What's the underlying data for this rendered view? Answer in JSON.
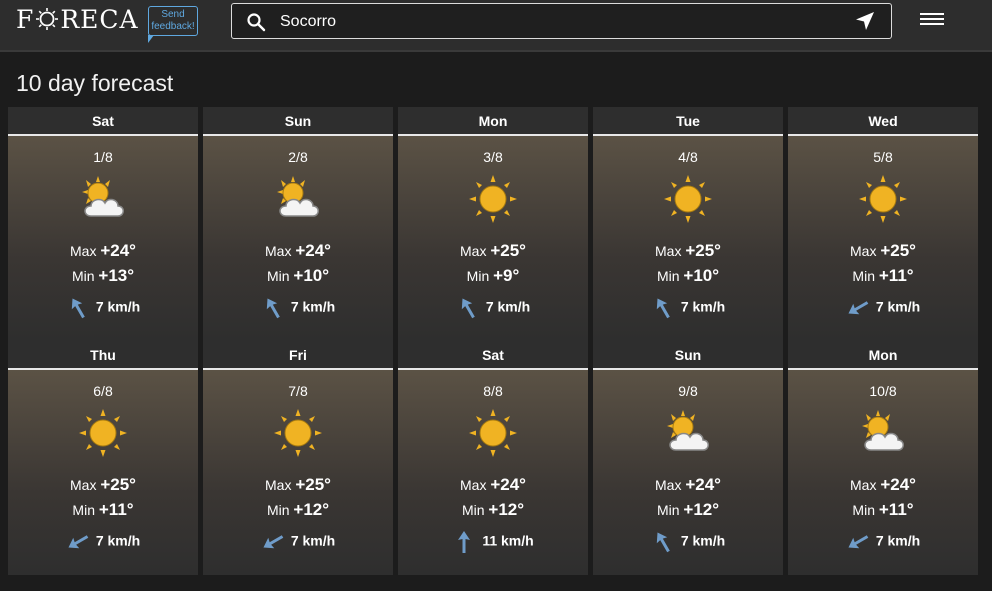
{
  "header": {
    "logo_text_left": "F",
    "logo_text_right": "RECA",
    "feedback_line1": "Send",
    "feedback_line2": "feedback!",
    "search_value": "Socorro",
    "colors": {
      "accent": "#5fa8e0",
      "sun": "#f0b323"
    }
  },
  "page": {
    "title": "10 day forecast"
  },
  "labels": {
    "max": "Max",
    "min": "Min"
  },
  "days": [
    {
      "day": "Sat",
      "date": "1/8",
      "icon": "partly-cloudy-icon",
      "max": "+24°",
      "min": "+13°",
      "wind": "7 km/h",
      "wind_dir": "nw"
    },
    {
      "day": "Sun",
      "date": "2/8",
      "icon": "partly-cloudy-icon",
      "max": "+24°",
      "min": "+10°",
      "wind": "7 km/h",
      "wind_dir": "nw"
    },
    {
      "day": "Mon",
      "date": "3/8",
      "icon": "sun-icon",
      "max": "+25°",
      "min": "+9°",
      "wind": "7 km/h",
      "wind_dir": "nw"
    },
    {
      "day": "Tue",
      "date": "4/8",
      "icon": "sun-icon",
      "max": "+25°",
      "min": "+10°",
      "wind": "7 km/h",
      "wind_dir": "nw"
    },
    {
      "day": "Wed",
      "date": "5/8",
      "icon": "sun-icon",
      "max": "+25°",
      "min": "+11°",
      "wind": "7 km/h",
      "wind_dir": "sw"
    },
    {
      "day": "Thu",
      "date": "6/8",
      "icon": "sun-icon",
      "max": "+25°",
      "min": "+11°",
      "wind": "7 km/h",
      "wind_dir": "sw"
    },
    {
      "day": "Fri",
      "date": "7/8",
      "icon": "sun-icon",
      "max": "+25°",
      "min": "+12°",
      "wind": "7 km/h",
      "wind_dir": "sw"
    },
    {
      "day": "Sat",
      "date": "8/8",
      "icon": "sun-icon",
      "max": "+24°",
      "min": "+12°",
      "wind": "11 km/h",
      "wind_dir": "n"
    },
    {
      "day": "Sun",
      "date": "9/8",
      "icon": "partly-cloudy-icon",
      "max": "+24°",
      "min": "+12°",
      "wind": "7 km/h",
      "wind_dir": "nw"
    },
    {
      "day": "Mon",
      "date": "10/8",
      "icon": "partly-cloudy-icon",
      "max": "+24°",
      "min": "+11°",
      "wind": "7 km/h",
      "wind_dir": "sw"
    }
  ]
}
